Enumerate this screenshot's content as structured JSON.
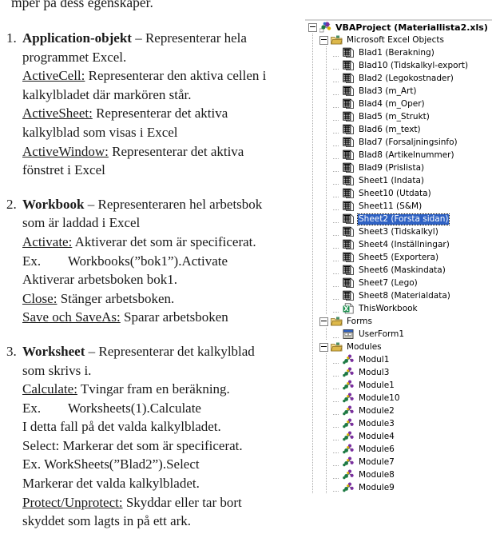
{
  "document": {
    "cut_top_line": "mper på dess egenskaper.",
    "items": [
      {
        "number": "1.",
        "lines": [
          [
            {
              "t": "Application-objekt",
              "s": "b"
            },
            {
              "t": " – Representerar hela",
              "s": ""
            }
          ],
          [
            {
              "t": "programmet Excel.",
              "s": ""
            }
          ],
          [
            {
              "t": "ActiveCell:",
              "s": "u"
            },
            {
              "t": " Representerar den aktiva cellen i",
              "s": ""
            }
          ],
          [
            {
              "t": "kalkylbladet där markören står.",
              "s": ""
            }
          ],
          [
            {
              "t": "ActiveSheet:",
              "s": "u"
            },
            {
              "t": " Representerar det aktiva",
              "s": ""
            }
          ],
          [
            {
              "t": "kalkylblad som visas i Excel",
              "s": ""
            }
          ],
          [
            {
              "t": "ActiveWindow:",
              "s": "u"
            },
            {
              "t": " Representerar det aktiva",
              "s": ""
            }
          ],
          [
            {
              "t": "fönstret i Excel",
              "s": ""
            }
          ]
        ]
      },
      {
        "number": "2.",
        "lines": [
          [
            {
              "t": "Workbook",
              "s": "b"
            },
            {
              "t": " – Representeraren hel arbetsbok",
              "s": ""
            }
          ],
          [
            {
              "t": "som är laddad i Excel",
              "s": ""
            }
          ],
          [
            {
              "t": "Activate:",
              "s": "u"
            },
            {
              "t": " Aktiverar det som är specificerat.",
              "s": ""
            }
          ],
          [
            {
              "t": "Ex.        Workbooks(”bok1”).Activate",
              "s": ""
            }
          ],
          [
            {
              "t": "Aktiverar arbetsboken bok1.",
              "s": ""
            }
          ],
          [
            {
              "t": "Close:",
              "s": "u"
            },
            {
              "t": " Stänger arbetsboken.",
              "s": ""
            }
          ],
          [
            {
              "t": "Save och SaveAs:",
              "s": "u"
            },
            {
              "t": " Sparar arbetsboken",
              "s": ""
            }
          ]
        ]
      },
      {
        "number": "3.",
        "lines": [
          [
            {
              "t": "Worksheet",
              "s": "b"
            },
            {
              "t": " – Representerar det kalkylblad",
              "s": ""
            }
          ],
          [
            {
              "t": "som skrivs i.",
              "s": ""
            }
          ],
          [
            {
              "t": "Calculate:",
              "s": "u"
            },
            {
              "t": " Tvingar fram en beräkning.",
              "s": ""
            }
          ],
          [
            {
              "t": "Ex.        Worksheets(1).Calculate",
              "s": ""
            }
          ],
          [
            {
              "t": "I detta fall på det valda kalkylbladet.",
              "s": ""
            }
          ],
          [
            {
              "t": "Select: Markerar det som är specificerat.",
              "s": ""
            }
          ],
          [
            {
              "t": "Ex. WorkSheets(”Blad2”).Select",
              "s": ""
            }
          ],
          [
            {
              "t": "Markerar det valda kalkylbladet.",
              "s": ""
            }
          ],
          [
            {
              "t": "Protect/Unprotect:",
              "s": "u"
            },
            {
              "t": " Skyddar eller tar bort",
              "s": ""
            }
          ],
          [
            {
              "t": "skyddet som lagts in på ett ark.",
              "s": ""
            }
          ]
        ]
      }
    ]
  },
  "project_explorer": {
    "selection_color": "#2f62c4",
    "nodes": [
      {
        "label": "VBAProject (Materiallista2.xls)",
        "icon": "vbaproject-icon",
        "indent": 0,
        "expander": "minus",
        "bold": true,
        "selected": false
      },
      {
        "label": "Microsoft Excel Objects",
        "icon": "folder-icon",
        "indent": 1,
        "expander": "minus",
        "bold": false,
        "selected": false
      },
      {
        "label": "Blad1 (Berakning)",
        "icon": "sheet-icon",
        "indent": 2,
        "expander": "dash",
        "bold": false,
        "selected": false
      },
      {
        "label": "Blad10 (Tidskalkyl-export)",
        "icon": "sheet-icon",
        "indent": 2,
        "expander": "dash",
        "bold": false,
        "selected": false
      },
      {
        "label": "Blad2 (Legokostnader)",
        "icon": "sheet-icon",
        "indent": 2,
        "expander": "dash",
        "bold": false,
        "selected": false
      },
      {
        "label": "Blad3 (m_Art)",
        "icon": "sheet-icon",
        "indent": 2,
        "expander": "dash",
        "bold": false,
        "selected": false
      },
      {
        "label": "Blad4 (m_Oper)",
        "icon": "sheet-icon",
        "indent": 2,
        "expander": "dash",
        "bold": false,
        "selected": false
      },
      {
        "label": "Blad5 (m_Strukt)",
        "icon": "sheet-icon",
        "indent": 2,
        "expander": "dash",
        "bold": false,
        "selected": false
      },
      {
        "label": "Blad6 (m_text)",
        "icon": "sheet-icon",
        "indent": 2,
        "expander": "dash",
        "bold": false,
        "selected": false
      },
      {
        "label": "Blad7 (Forsaljningsinfo)",
        "icon": "sheet-icon",
        "indent": 2,
        "expander": "dash",
        "bold": false,
        "selected": false
      },
      {
        "label": "Blad8 (Artikelnummer)",
        "icon": "sheet-icon",
        "indent": 2,
        "expander": "dash",
        "bold": false,
        "selected": false
      },
      {
        "label": "Blad9 (Prislista)",
        "icon": "sheet-icon",
        "indent": 2,
        "expander": "dash",
        "bold": false,
        "selected": false
      },
      {
        "label": "Sheet1 (Indata)",
        "icon": "sheet-icon",
        "indent": 2,
        "expander": "dash",
        "bold": false,
        "selected": false
      },
      {
        "label": "Sheet10 (Utdata)",
        "icon": "sheet-icon",
        "indent": 2,
        "expander": "dash",
        "bold": false,
        "selected": false
      },
      {
        "label": "Sheet11 (S&M)",
        "icon": "sheet-icon",
        "indent": 2,
        "expander": "dash",
        "bold": false,
        "selected": false
      },
      {
        "label": "Sheet2 (Forsta sidan)",
        "icon": "sheet-icon",
        "indent": 2,
        "expander": "dash",
        "bold": false,
        "selected": true
      },
      {
        "label": "Sheet3 (Tidskalkyl)",
        "icon": "sheet-icon",
        "indent": 2,
        "expander": "dash",
        "bold": false,
        "selected": false
      },
      {
        "label": "Sheet4 (Inställningar)",
        "icon": "sheet-icon",
        "indent": 2,
        "expander": "dash",
        "bold": false,
        "selected": false
      },
      {
        "label": "Sheet5 (Exportera)",
        "icon": "sheet-icon",
        "indent": 2,
        "expander": "dash",
        "bold": false,
        "selected": false
      },
      {
        "label": "Sheet6 (Maskindata)",
        "icon": "sheet-icon",
        "indent": 2,
        "expander": "dash",
        "bold": false,
        "selected": false
      },
      {
        "label": "Sheet7 (Lego)",
        "icon": "sheet-icon",
        "indent": 2,
        "expander": "dash",
        "bold": false,
        "selected": false
      },
      {
        "label": "Sheet8 (Materialdata)",
        "icon": "sheet-icon",
        "indent": 2,
        "expander": "dash",
        "bold": false,
        "selected": false
      },
      {
        "label": "ThisWorkbook",
        "icon": "workbook-icon",
        "indent": 2,
        "expander": "dash",
        "bold": false,
        "selected": false
      },
      {
        "label": "Forms",
        "icon": "folder-icon",
        "indent": 1,
        "expander": "minus",
        "bold": false,
        "selected": false
      },
      {
        "label": "UserForm1",
        "icon": "userform-icon",
        "indent": 2,
        "expander": "dash",
        "bold": false,
        "selected": false
      },
      {
        "label": "Modules",
        "icon": "folder-icon",
        "indent": 1,
        "expander": "minus",
        "bold": false,
        "selected": false
      },
      {
        "label": "Modul1",
        "icon": "module-icon",
        "indent": 2,
        "expander": "dash",
        "bold": false,
        "selected": false
      },
      {
        "label": "Modul3",
        "icon": "module-icon",
        "indent": 2,
        "expander": "dash",
        "bold": false,
        "selected": false
      },
      {
        "label": "Module1",
        "icon": "module-icon",
        "indent": 2,
        "expander": "dash",
        "bold": false,
        "selected": false
      },
      {
        "label": "Module10",
        "icon": "module-icon",
        "indent": 2,
        "expander": "dash",
        "bold": false,
        "selected": false
      },
      {
        "label": "Module2",
        "icon": "module-icon",
        "indent": 2,
        "expander": "dash",
        "bold": false,
        "selected": false
      },
      {
        "label": "Module3",
        "icon": "module-icon",
        "indent": 2,
        "expander": "dash",
        "bold": false,
        "selected": false
      },
      {
        "label": "Module4",
        "icon": "module-icon",
        "indent": 2,
        "expander": "dash",
        "bold": false,
        "selected": false
      },
      {
        "label": "Module6",
        "icon": "module-icon",
        "indent": 2,
        "expander": "dash",
        "bold": false,
        "selected": false
      },
      {
        "label": "Module7",
        "icon": "module-icon",
        "indent": 2,
        "expander": "dash",
        "bold": false,
        "selected": false
      },
      {
        "label": "Module8",
        "icon": "module-icon",
        "indent": 2,
        "expander": "dash",
        "bold": false,
        "selected": false
      },
      {
        "label": "Module9",
        "icon": "module-icon",
        "indent": 2,
        "expander": "dash",
        "bold": false,
        "selected": false
      }
    ]
  }
}
